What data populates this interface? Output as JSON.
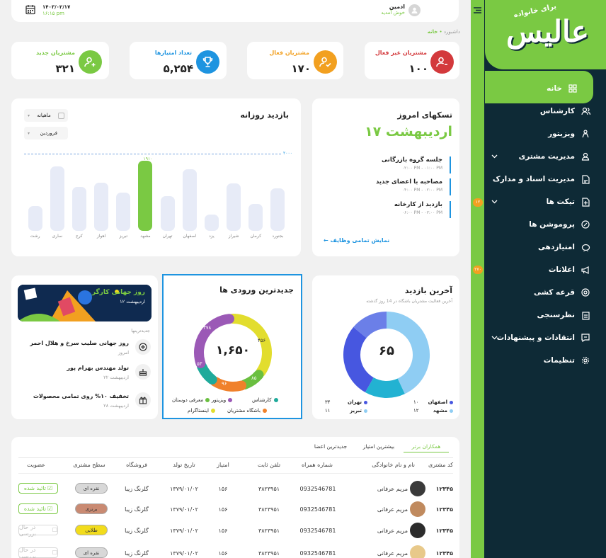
{
  "header": {
    "date": "۱۴۰۳/۰۲/۱۷",
    "time": "۱۶:۱۵ pm",
    "user": "ادمین",
    "welcome": "خوش آمدید"
  },
  "breadcrumb": {
    "parent": "داشبورد",
    "current": "خانه"
  },
  "stats": [
    {
      "label": "مشتریان غیر فعال",
      "value": "۱۰۰",
      "color": "#d3393c"
    },
    {
      "label": "مشتریان فعال",
      "value": "۱۷۰",
      "color": "#f2a020"
    },
    {
      "label": "تعداد امتیازها",
      "value": "۵,۲۵۴",
      "color": "#1e94e0"
    },
    {
      "label": "مشتریان جدید",
      "value": "۳۲۱",
      "color": "#7ac943"
    }
  ],
  "tasks": {
    "title": "تسکهای امروز",
    "date": "۱۷ اردیبهشت",
    "items": [
      {
        "title": "جلسه گروه بازرگانی",
        "time": "۰۲:۰۰ PM - ۰۱:۰۰ PM"
      },
      {
        "title": "مصاحبه با اعضای جدید",
        "time": "۰۴:۰۰ PM - ۰۲:۰۰ PM"
      },
      {
        "title": "بازدید از کارخانه",
        "time": "۰۶:۰۰ PM - ۰۳:۰۰ PM"
      }
    ],
    "link": "نمایش تمامی وظایف"
  },
  "daily": {
    "title": "بازدید روزانه",
    "filter1": "ماهیانه",
    "filter2": "فروردین",
    "target": "۲۰۰۰",
    "peak": "۱۹۱۰"
  },
  "chart_data": [
    {
      "type": "bar",
      "title": "بازدید روزانه",
      "categories": [
        "بجنورد",
        "کرمان",
        "شیراز",
        "یزد",
        "اصفهان",
        "تهران",
        "مشهد",
        "تبریز",
        "اهواز",
        "کرج",
        "ساری",
        "رشت"
      ],
      "values": [
        1150,
        730,
        1290,
        450,
        1670,
        940,
        1910,
        1050,
        1310,
        1200,
        1750,
        680
      ],
      "ylim": [
        0,
        2000
      ],
      "target": 2000
    },
    {
      "type": "pie",
      "title": "آخرین بازدید",
      "center": "۶۵",
      "labels": [
        "اصفهان",
        "تهران",
        "مشهد",
        "تبریز"
      ],
      "values": [
        10,
        34,
        12,
        11
      ],
      "colors": [
        "#4757e0",
        "#8fcdf3",
        "#22b2d2",
        "#6b7fe8"
      ]
    },
    {
      "type": "pie",
      "title": "جدیدترین ورودی ها",
      "center": "۱,۶۵۰",
      "labels": [
        "کارشناس",
        "ویزیتور",
        "معرفی دوستان",
        "باشگاه مشتریان",
        "اینستاگرام"
      ],
      "values": [
        53,
        378,
        456,
        85,
        96
      ],
      "colors": [
        "#1faa9b",
        "#9b59b6",
        "#e2dd2e",
        "#6abf40",
        "#f0812b"
      ]
    }
  ],
  "last_visit": {
    "title": "آخرین بازدید",
    "subtitle": "آخرین فعالیت مشتریان باشگاه در 14 روز گذشته",
    "center": "۶۵",
    "legend": [
      {
        "name": "اصفهان",
        "value": "۱۰",
        "color": "#4757e0"
      },
      {
        "name": "تهران",
        "value": "۳۴",
        "color": "#4757e0"
      },
      {
        "name": "مشهد",
        "value": "۱۲",
        "color": "#8fcdf3"
      },
      {
        "name": "تبریز",
        "value": "۱۱",
        "color": "#8fcdf3"
      }
    ]
  },
  "new_entries": {
    "title": "جدیدترین ورودی ها",
    "total": "۱,۶۵۰",
    "labels": [
      "۴۵۶",
      "۸۵",
      "۹۶",
      "۵۳",
      "۳۷۸"
    ],
    "legend": [
      {
        "name": "کارشناس",
        "color": "#1faa9b"
      },
      {
        "name": "ویزیتور",
        "color": "#9b59b6"
      },
      {
        "name": "معرفی دوستان",
        "color": "#6abf40"
      },
      {
        "name": "باشگاه مشتریان",
        "color": "#f0812b"
      },
      {
        "name": "اینستاگرام",
        "color": "#e2dd2e"
      }
    ]
  },
  "events": {
    "banner_title": "روز جهانی کارگر",
    "banner_date": "۱۲ اردیبهشت",
    "section": "جدیدترینها",
    "items": [
      {
        "title": "روز جهانی صلیب سرخ و هلال احمر",
        "date": "امروز"
      },
      {
        "title": "تولد مهندس بهرام پور",
        "date": "۲۲ اردیبهشت"
      },
      {
        "title": "تخفیف ۱۰% روی تمامی محصولات",
        "date": "۲۸ اردیبهشت"
      }
    ]
  },
  "table": {
    "tabs": [
      "همکاران برتر",
      "بیشترین امتیاز",
      "جدیدترین اعضا"
    ],
    "columns": [
      "کد مشتری",
      "نام و نام خانوادگی",
      "شماره همراه",
      "تلفن ثابت",
      "امتیاز",
      "تاریخ تولد",
      "فروشگاه",
      "سطح مشتری",
      "عضویت"
    ],
    "rows": [
      {
        "code": "۱۲۳۴۵",
        "name": "مریم عرفانی",
        "mobile": "0932546781",
        "phone": "۳۸۲۳۹۵۱",
        "score": "۱۵۶",
        "birth": "۱۳۷۹/۰۱/۰۲",
        "store": "گلرنگ زیبا",
        "level": "نقره ای",
        "level_color": "#d8d8d8",
        "status": "تائید شده",
        "ok": true
      },
      {
        "code": "۱۲۳۴۵",
        "name": "مریم عرفانی",
        "mobile": "0932546781",
        "phone": "۳۸۲۳۹۵۱",
        "score": "۱۵۶",
        "birth": "۱۳۷۹/۰۱/۰۲",
        "store": "گلرنگ زیبا",
        "level": "برنزی",
        "level_color": "#c98a72",
        "status": "تائید شده",
        "ok": true
      },
      {
        "code": "۱۲۳۴۵",
        "name": "مریم عرفانی",
        "mobile": "0932546781",
        "phone": "۳۸۲۳۹۵۱",
        "score": "۱۵۶",
        "birth": "۱۳۷۹/۰۱/۰۲",
        "store": "گلرنگ زیبا",
        "level": "طلایی",
        "level_color": "#f2dc1c",
        "status": "در حال بررسی",
        "ok": false
      },
      {
        "code": "۱۲۳۴۵",
        "name": "مریم عرفانی",
        "mobile": "0932546781",
        "phone": "۳۸۲۳۹۵۱",
        "score": "۱۵۶",
        "birth": "۱۳۷۹/۰۱/۰۲",
        "store": "گلرنگ زیبا",
        "level": "نقره ای",
        "level_color": "#d8d8d8",
        "status": "در حال بررسی",
        "ok": false
      }
    ]
  },
  "sidebar": {
    "logo_small": "برای خانواده",
    "logo": "عالیس",
    "items": [
      {
        "label": "خانه",
        "badge": ""
      },
      {
        "label": "کارشناس",
        "badge": ""
      },
      {
        "label": "ویزیتور",
        "badge": ""
      },
      {
        "label": "مدیریت مشتری",
        "badge": ""
      },
      {
        "label": "مدیریت اسناد و مدارک",
        "badge": ""
      },
      {
        "label": "تیکت ها",
        "badge": "۱۲"
      },
      {
        "label": "پروموشن ها",
        "badge": ""
      },
      {
        "label": "امتیازدهی",
        "badge": ""
      },
      {
        "label": "اعلانات",
        "badge": "۲۷۰"
      },
      {
        "label": "قرعه کشی",
        "badge": ""
      },
      {
        "label": "نظرسنجی",
        "badge": ""
      },
      {
        "label": "انتقادات و پیشنهادات",
        "badge": ""
      },
      {
        "label": "تنظیمات",
        "badge": ""
      }
    ]
  }
}
